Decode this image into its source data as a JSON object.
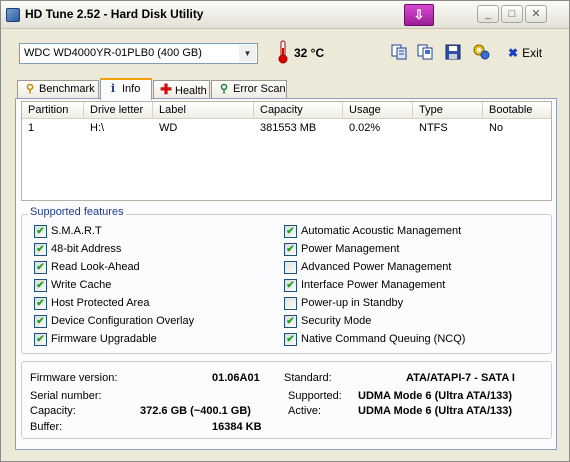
{
  "window": {
    "title": "HD Tune 2.52 - Hard Disk Utility",
    "badge_icon": "download-arrow-icon",
    "controls": [
      "_",
      "□",
      "✕"
    ]
  },
  "toolbar": {
    "drive": "WDC WD4000YR-01PLB0 (400 GB)",
    "temperature": "32 °C",
    "exit_label": "Exit",
    "exit_underline": "x",
    "icons": [
      "copy-info-icon",
      "copy-screen-icon",
      "save-icon",
      "options-icon"
    ]
  },
  "tabs": [
    {
      "label": "Benchmark",
      "icon": "benchmark-icon"
    },
    {
      "label": "Info",
      "icon": "info-icon",
      "active": true
    },
    {
      "label": "Health",
      "icon": "health-cross-icon"
    },
    {
      "label": "Error Scan",
      "icon": "magnifier-icon"
    }
  ],
  "partitions": {
    "columns": [
      "Partition",
      "Drive letter",
      "Label",
      "Capacity",
      "Usage",
      "Type",
      "Bootable"
    ],
    "rows": [
      [
        "1",
        "H:\\",
        "WD",
        "381553 MB",
        "0.02%",
        "NTFS",
        "No"
      ]
    ]
  },
  "features": {
    "title": "Supported features",
    "left": [
      {
        "label": "S.M.A.R.T",
        "checked": true
      },
      {
        "label": "48-bit Address",
        "checked": true
      },
      {
        "label": "Read Look-Ahead",
        "checked": true
      },
      {
        "label": "Write Cache",
        "checked": true
      },
      {
        "label": "Host Protected Area",
        "checked": true
      },
      {
        "label": "Device Configuration Overlay",
        "checked": true
      },
      {
        "label": "Firmware Upgradable",
        "checked": true
      }
    ],
    "right": [
      {
        "label": "Automatic Acoustic Management",
        "checked": true
      },
      {
        "label": "Power Management",
        "checked": true
      },
      {
        "label": "Advanced Power Management",
        "checked": false
      },
      {
        "label": "Interface Power Management",
        "checked": true
      },
      {
        "label": "Power-up in Standby",
        "checked": false
      },
      {
        "label": "Security Mode",
        "checked": true
      },
      {
        "label": "Native Command Queuing (NCQ)",
        "checked": true
      }
    ]
  },
  "details": {
    "firmware_label": "Firmware version:",
    "firmware_value": "01.06A01",
    "serial_label": "Serial number:",
    "serial_value": "",
    "capacity_label": "Capacity:",
    "capacity_value": "372.6 GB (~400.1 GB)",
    "buffer_label": "Buffer:",
    "buffer_value": "16384 KB",
    "standard_label": "Standard:",
    "standard_value": "ATA/ATAPI-7 - SATA I",
    "supported_label": "Supported:",
    "supported_value": "UDMA Mode 6 (Ultra ATA/133)",
    "active_label": "Active:",
    "active_value": "UDMA Mode 6 (Ultra ATA/133)"
  },
  "colors": {
    "window_bg": "#ece9d8",
    "check_green": "#21a121",
    "legend_blue": "#1c3c8c",
    "badge_magenta": "#c032b8",
    "active_tab_accent": "#f0a000"
  }
}
